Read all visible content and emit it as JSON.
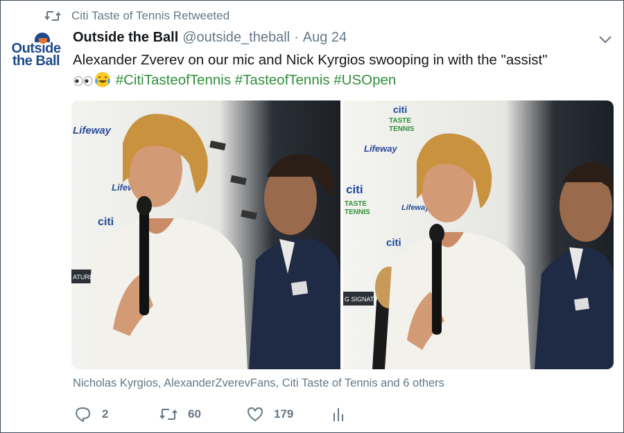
{
  "retweet": {
    "text": "Citi Taste of Tennis Retweeted",
    "icon": "retweet-icon"
  },
  "author": {
    "avatar_line1": "Outside",
    "avatar_line2": "the Ball",
    "name": "Outside the Ball",
    "handle": "@outside_theball",
    "separator": "·",
    "date": "Aug 24"
  },
  "tweet": {
    "text_line1": "Alexander Zverev on our mic and Nick Kyrgios swooping in with the \"assist\"",
    "hashtags": [
      "#CitiTasteofTennis",
      "#TasteofTennis",
      "#USOpen"
    ],
    "emojis": [
      "eyes-emoji",
      "laughing-tears-emoji"
    ]
  },
  "media": {
    "backdrop_texts": {
      "lifeway": "Lifeway",
      "citi": "citi",
      "taste_line1": "TASTE",
      "taste_line2": "TENNIS",
      "signature_left": "ATURE",
      "signature_right": "G SIGNAT"
    }
  },
  "tagged": "Nicholas Kyrgios, AlexanderZverevFans, Citi Taste of Tennis and 6 others",
  "actions": {
    "reply_count": "2",
    "retweet_count": "60",
    "like_count": "179"
  },
  "colors": {
    "text": "#14171a",
    "muted": "#657786",
    "hashtag": "#2f8f3a",
    "logo": "#1e4a8a",
    "logo_accent": "#e8722a"
  }
}
